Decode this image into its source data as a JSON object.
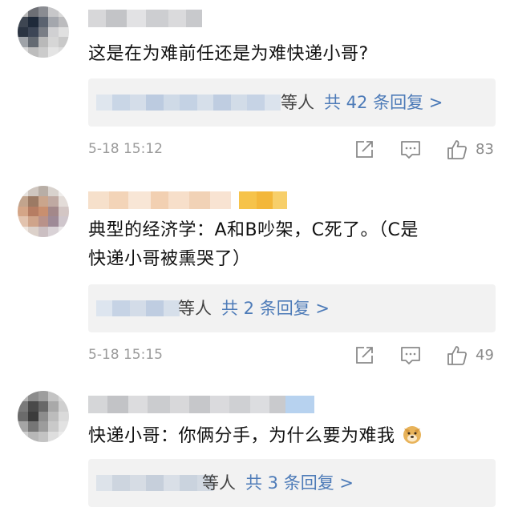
{
  "comments": [
    {
      "text": "这是在为难前任还是为难快递小哥?",
      "replies": {
        "wait": "等人",
        "total": "共 42 条回复 >"
      },
      "time": "5-18 15:12",
      "likes": "83"
    },
    {
      "text_line1": "典型的经济学：A和B吵架，C死了。（C是",
      "text_line2": "快递小哥被熏哭了）",
      "replies": {
        "wait": "等人",
        "total": "共 2 条回复 >"
      },
      "time": "5-18 15:15",
      "likes": "49"
    },
    {
      "text": "快递小哥：你俩分手，为什么要为难我",
      "emoji": "doge-emoji",
      "replies": {
        "wait": "等人",
        "total": "共 3 条回复 >"
      }
    }
  ],
  "icons": [
    "share-icon",
    "comment-icon",
    "like-icon"
  ],
  "colors": {
    "link_blue": "#4d7bb8",
    "reply_bg": "#f2f2f2",
    "meta_gray": "#9a9a9a"
  }
}
